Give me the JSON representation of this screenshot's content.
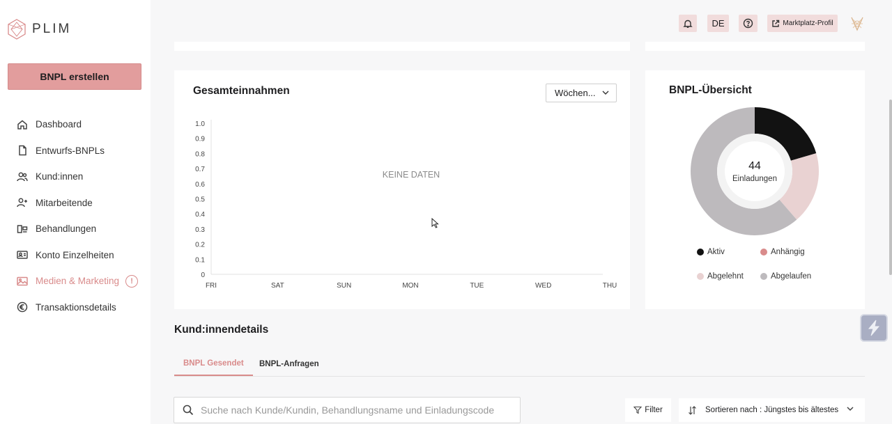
{
  "brand": {
    "name": "PLIM"
  },
  "sidebar": {
    "create_button": "BNPL erstellen",
    "items": [
      {
        "label": "Dashboard",
        "icon": "home-icon"
      },
      {
        "label": "Entwurfs-BNPLs",
        "icon": "file-icon"
      },
      {
        "label": "Kund:innen",
        "icon": "users-icon"
      },
      {
        "label": "Mitarbeitende",
        "icon": "user-plus-icon"
      },
      {
        "label": "Behandlungen",
        "icon": "treatments-icon"
      },
      {
        "label": "Konto Einzelheiten",
        "icon": "id-card-icon"
      },
      {
        "label": "Medien & Marketing",
        "icon": "image-icon"
      },
      {
        "label": "Transaktionsdetails",
        "icon": "euro-icon"
      }
    ],
    "warning_mark": "!"
  },
  "topbar": {
    "language": "DE",
    "marketplace_label": "Marktplatz-Profil"
  },
  "revenue": {
    "title": "Gesamteinnahmen",
    "period_select": "Wöchen...",
    "no_data": "KEINE DATEN"
  },
  "chart_data": {
    "type": "bar",
    "title": "Gesamteinnahmen",
    "categories": [
      "FRI",
      "SAT",
      "SUN",
      "MON",
      "TUE",
      "WED",
      "THU"
    ],
    "values": [],
    "ylim": [
      0,
      1.0
    ],
    "yticks": [
      "1.0",
      "0.9",
      "0.8",
      "0.7",
      "0.6",
      "0.5",
      "0.4",
      "0.3",
      "0.2",
      "0.1",
      "0"
    ],
    "annotation": "KEINE DATEN"
  },
  "overview": {
    "title": "BNPL-Übersicht",
    "total": "44",
    "total_label": "Einladungen",
    "chart_data": {
      "type": "pie",
      "labels": [
        "Aktiv",
        "Anhängig",
        "Abgelehnt",
        "Abgelaufen"
      ],
      "values": [
        9,
        0,
        8,
        27
      ],
      "colors": [
        "#121212",
        "#d98b8b",
        "#e9d2d2",
        "#bdbabd"
      ]
    }
  },
  "customers": {
    "title": "Kund:innendetails",
    "tabs": [
      "BNPL Gesendet",
      "BNPL-Anfragen"
    ],
    "search_placeholder": "Suche nach Kunde/Kundin, Behandlungsname und Einladungscode",
    "filter_label": "Filter",
    "sort_label": "Sortieren nach : Jüngstes bis ältestes"
  }
}
